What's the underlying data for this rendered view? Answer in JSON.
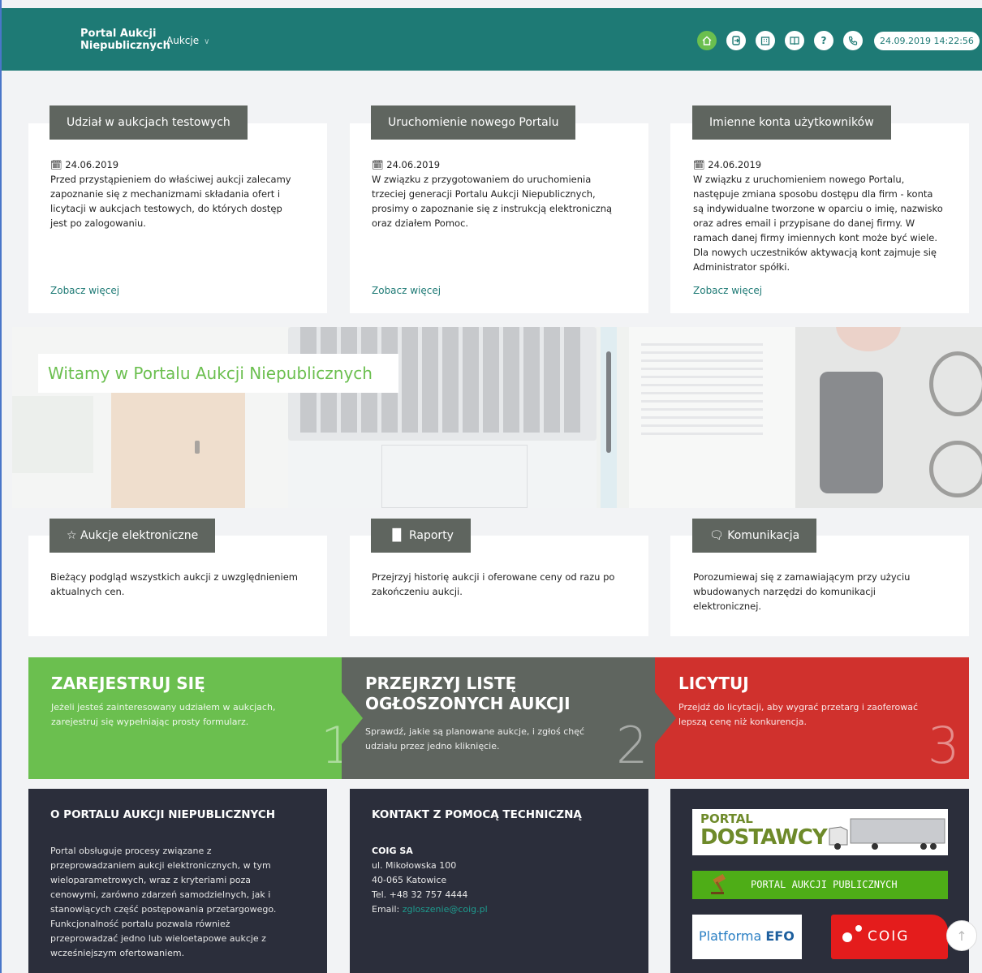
{
  "header": {
    "brand_line1": "Portal Aukcji",
    "brand_line2": "Niepublicznych",
    "menu_label": "Aukcje",
    "icons": [
      "home-icon",
      "login-icon",
      "building-icon",
      "book-icon",
      "help-icon",
      "phone-icon"
    ],
    "datetime": "24.09.2019 14:22:56"
  },
  "news": [
    {
      "title": "Udział w aukcjach testowych",
      "date": "24.06.2019",
      "lines": [
        "Przed przystąpieniem do właściwej aukcji zalecamy",
        "zapoznanie się z mechanizmami składania ofert i",
        "licytacji w aukcjach testowych, do których dostęp",
        "jest po zalogowaniu."
      ],
      "link": "Zobacz więcej"
    },
    {
      "title": "Uruchomienie nowego Portalu",
      "date": "24.06.2019",
      "lines": [
        "W związku z przygotowaniem do uruchomienia",
        "trzeciej generacji Portalu Aukcji Niepublicznych,",
        "prosimy o zapoznanie się z instrukcją elektroniczną",
        "oraz działem Pomoc."
      ],
      "link": "Zobacz więcej"
    },
    {
      "title": "Imienne konta użytkowników",
      "date": "24.06.2019",
      "lines": [
        "W związku z uruchomieniem nowego Portalu,",
        "następuje zmiana sposobu dostępu dla firm - konta",
        "są indywidualne tworzone w oparciu o imię, nazwisko",
        "oraz adres email i przypisane do danej firmy. W",
        "ramach danej firmy imiennych kont może być wiele.",
        "Dla nowych uczestników aktywacją kont zajmuje się",
        "Administrator spółki."
      ],
      "link": "Zobacz więcej"
    }
  ],
  "banner": {
    "title": "Witamy w Portalu Aukcji Niepublicznych"
  },
  "features": [
    {
      "icon": "star-icon",
      "title": "Aukcje elektroniczne",
      "lines": [
        "Bieżący podgląd wszystkich aukcji z uwzględnieniem",
        "aktualnych cen."
      ]
    },
    {
      "icon": "chart-icon",
      "title": "Raporty",
      "lines": [
        "Przejrzyj historię aukcji i oferowane ceny od razu po",
        "zakończeniu aukcji."
      ]
    },
    {
      "icon": "chat-icon",
      "title": "Komunikacja",
      "lines": [
        "Porozumiewaj się z zamawiającym przy użyciu",
        "wbudowanych narzędzi do komunikacji",
        "elektronicznej."
      ]
    }
  ],
  "steps": [
    {
      "title_lines": [
        "ZAREJESTRUJ SIĘ"
      ],
      "text_lines": [
        "Jeżeli jesteś zainteresowany udziałem w aukcjach,",
        "zarejestruj się wypełniając prosty formularz."
      ],
      "number": "1",
      "color": "#6bbf4f"
    },
    {
      "title_lines": [
        "PRZEJRZYJ LISTĘ",
        "OGŁOSZONYCH AUKCJI"
      ],
      "text_lines": [
        "Sprawdź, jakie są planowane aukcje, i zgłoś chęć",
        "udziału przez jedno kliknięcie."
      ],
      "number": "2",
      "color": "#5f655f"
    },
    {
      "title_lines": [
        "LICYTUJ"
      ],
      "text_lines": [
        "Przejdź do licytacji, aby wygrać przetarg i zaoferować",
        "lepszą cenę niż konkurencja."
      ],
      "number": "3",
      "color": "#d0312d"
    }
  ],
  "footer": {
    "about": {
      "title": "O PORTALU AUKCJI NIEPUBLICZNYCH",
      "lines": [
        "Portal obsługuje procesy związane z",
        "przeprowadzaniem aukcji elektronicznych, w tym",
        "wieloparametrowych, wraz z kryteriami poza",
        "cenowymi, zarówno zdarzeń samodzielnych, jak i",
        "stanowiących część postępowania przetargowego.",
        "Funkcjonalność portalu pozwala również",
        "przeprowadzać jedno lub wieloetapowe aukcje z",
        "wcześniejszym ofertowaniem."
      ]
    },
    "contact": {
      "title": "KONTAKT Z POMOCĄ TECHNICZNĄ",
      "company": "COIG SA",
      "street": "ul. Mikołowska 100",
      "city": "40-065 Katowice",
      "phone": "Tel. +48 32 757 4444",
      "email_label": "Email:",
      "email": "zgloszenie@coig.pl"
    },
    "partners": {
      "dostawcy_line1": "PORTAL",
      "dostawcy_line2": "DOSTAWCY",
      "publiczne": "PORTAL AUKCJI PUBLICZNYCH",
      "efo_prefix": "Platforma",
      "efo_suffix": "EFO",
      "coig": "COIG"
    }
  },
  "colors": {
    "header": "#1e7a75",
    "accent_green": "#6bbf4f",
    "tab_gray": "#5f655f",
    "red": "#d0312d",
    "footer": "#2b2e3b"
  }
}
